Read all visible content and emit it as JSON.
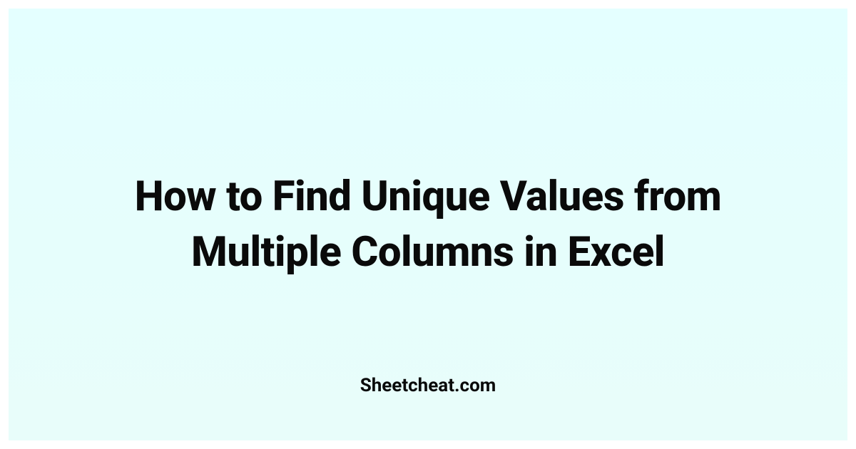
{
  "title": "How to Find Unique Values from Multiple Columns in Excel",
  "domain": "Sheetcheat.com"
}
